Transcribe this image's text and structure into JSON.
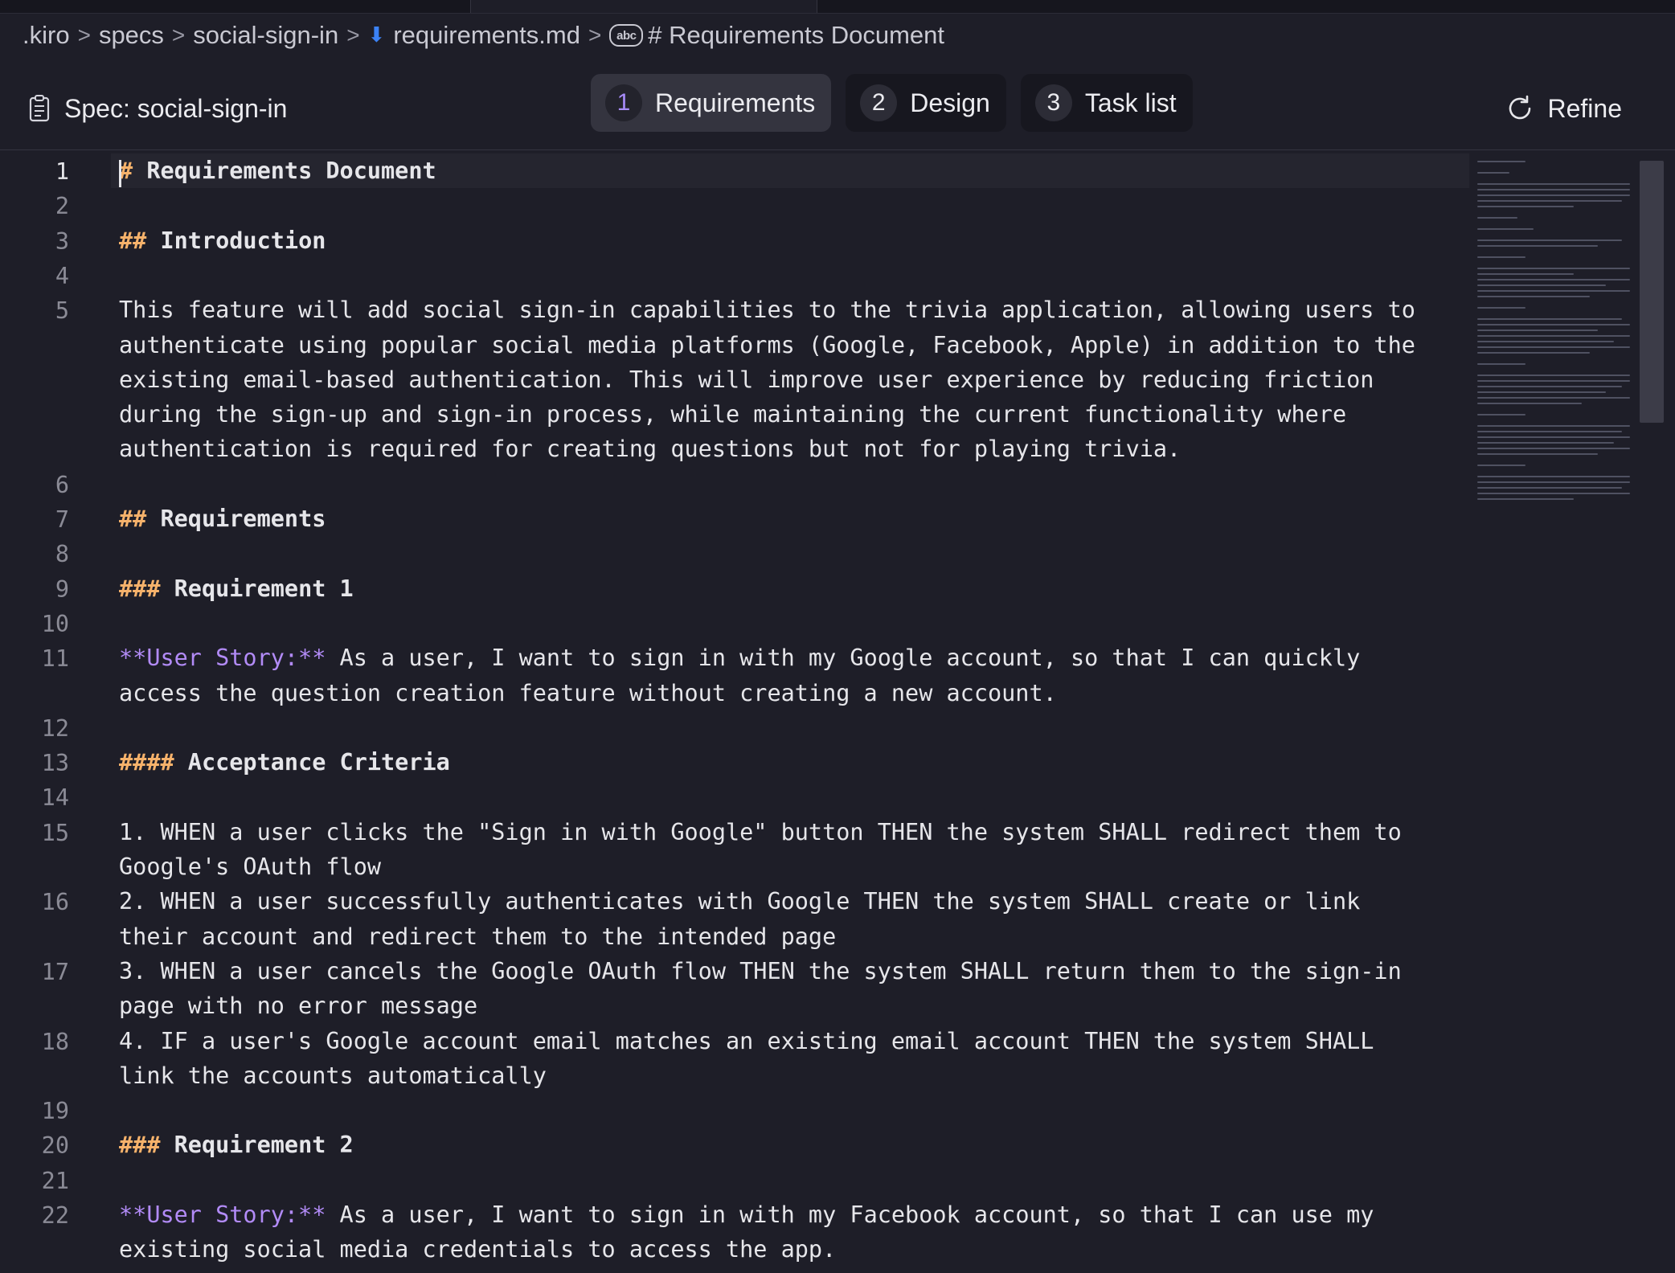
{
  "breadcrumb": {
    "items": [
      ".kiro",
      "specs",
      "social-sign-in",
      "requirements.md",
      "# Requirements Document"
    ],
    "separator": ">"
  },
  "spec": {
    "title": "Spec: social-sign-in"
  },
  "steps": [
    {
      "num": "1",
      "label": "Requirements",
      "active": true
    },
    {
      "num": "2",
      "label": "Design",
      "active": false
    },
    {
      "num": "3",
      "label": "Task list",
      "active": false
    }
  ],
  "refine_label": "Refine",
  "editor": {
    "current_line": 1,
    "lines": [
      {
        "n": "1",
        "text": "# Requirements Document"
      },
      {
        "n": "2",
        "text": ""
      },
      {
        "n": "3",
        "text": "## Introduction"
      },
      {
        "n": "4",
        "text": ""
      },
      {
        "n": "5",
        "text": "This feature will add social sign-in capabilities to the trivia application, allowing users to authenticate using popular social media platforms (Google, Facebook, Apple) in addition to the existing email-based authentication. This will improve user experience by reducing friction during the sign-up and sign-in process, while maintaining the current functionality where authentication is required for creating questions but not for playing trivia."
      },
      {
        "n": "6",
        "text": ""
      },
      {
        "n": "7",
        "text": "## Requirements"
      },
      {
        "n": "8",
        "text": ""
      },
      {
        "n": "9",
        "text": "### Requirement 1"
      },
      {
        "n": "10",
        "text": ""
      },
      {
        "n": "11",
        "text": "**User Story:** As a user, I want to sign in with my Google account, so that I can quickly access the question creation feature without creating a new account."
      },
      {
        "n": "12",
        "text": ""
      },
      {
        "n": "13",
        "text": "#### Acceptance Criteria"
      },
      {
        "n": "14",
        "text": ""
      },
      {
        "n": "15",
        "text": "1. WHEN a user clicks the \"Sign in with Google\" button THEN the system SHALL redirect them to Google's OAuth flow"
      },
      {
        "n": "16",
        "text": "2. WHEN a user successfully authenticates with Google THEN the system SHALL create or link their account and redirect them to the intended page"
      },
      {
        "n": "17",
        "text": "3. WHEN a user cancels the Google OAuth flow THEN the system SHALL return them to the sign-in page with no error message"
      },
      {
        "n": "18",
        "text": "4. IF a user's Google account email matches an existing email account THEN the system SHALL link the accounts automatically"
      },
      {
        "n": "19",
        "text": ""
      },
      {
        "n": "20",
        "text": "### Requirement 2"
      },
      {
        "n": "21",
        "text": ""
      },
      {
        "n": "22",
        "text": "**User Story:** As a user, I want to sign in with my Facebook account, so that I can use my existing social media credentials to access the app."
      }
    ]
  },
  "colors": {
    "background": "#1e1e28",
    "heading_marker": "#f6b26b",
    "user_story": "#b28bf7",
    "active_step_number": "#a78bfa",
    "file_icon": "#3b82f6"
  },
  "icons": {
    "file": "markdown-file-icon",
    "symbol": "abc-symbol-icon",
    "spec": "clipboard-icon",
    "refine": "refresh-icon"
  }
}
